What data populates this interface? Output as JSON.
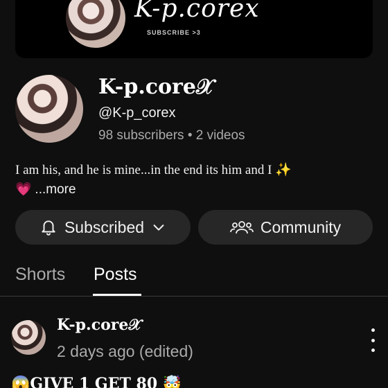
{
  "banner": {
    "title": "K-p.corex",
    "subtitle": "SUBSCRIBE >3"
  },
  "channel": {
    "name": "K-p.core𝒳",
    "handle": "@K-p_corex",
    "subscribers": "98 subscribers",
    "separator": "•",
    "videos": "2 videos",
    "description": "I am his, and he is mine...in the end its him and I ✨",
    "description_emoji": "💗",
    "more_label": "...more"
  },
  "actions": {
    "subscribed_label": "Subscribed",
    "community_label": "Community"
  },
  "tabs": [
    {
      "label": "Shorts",
      "active": false
    },
    {
      "label": "Posts",
      "active": true
    }
  ],
  "post": {
    "author": "K-p.core𝒳",
    "time": "2 days ago (edited)",
    "text": "😱GIVE 1 GET 80 🤯"
  },
  "colors": {
    "background": "#0f0f0f",
    "pill": "#272727",
    "muted_text": "#aaaaaa",
    "text": "#f1f1f1"
  }
}
